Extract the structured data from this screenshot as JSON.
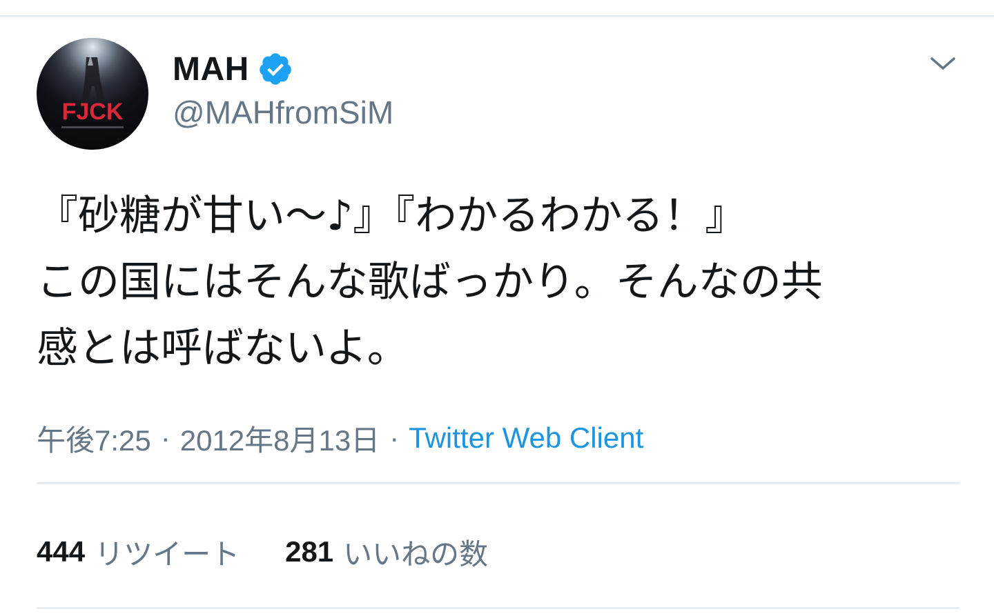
{
  "tweet": {
    "display_name": "MAH",
    "handle": "@MAHfromSiM",
    "verified": true,
    "text": "『砂糖が甘い〜♪』『わかるわかる！』\nこの国にはそんな歌ばっかり。そんなの共\n感とは呼ばないよ。",
    "time": "午後7:25",
    "separator": "·",
    "date": "2012年8月13日",
    "client": "Twitter Web Client"
  },
  "stats": {
    "retweets_count": "444",
    "retweets_label": "リツイート",
    "likes_count": "281",
    "likes_label": "いいねの数"
  },
  "avatar": {
    "text": "FJCK"
  },
  "icons": {
    "verified": "verified-badge-icon",
    "more": "chevron-down-icon"
  },
  "colors": {
    "accent": "#1da1f2",
    "link": "#1b95e0",
    "text": "#14171a",
    "secondary": "#657786",
    "divider": "#e6ecf0",
    "avatar_text": "#d8283a"
  }
}
